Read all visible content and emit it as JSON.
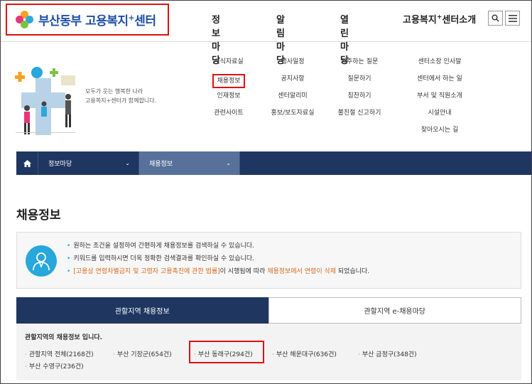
{
  "header": {
    "logo_text": "부산동부 고용복지",
    "logo_sup": "+",
    "logo_suffix": "센터",
    "nav": [
      "정보마당",
      "알림마당",
      "열린마당"
    ],
    "nav_last_prefix": "고용복지",
    "nav_last_sup": "+",
    "nav_last_suffix": "센터소개"
  },
  "mega": {
    "slogan_line1": "모두가 웃는 행복한 나라",
    "slogan_line2": "고용복지+센터가 함께합니다.",
    "col1": [
      "서식자료실",
      "채용정보",
      "인재정보",
      "관련사이트"
    ],
    "col2": [
      "행사일정",
      "공지사항",
      "센터알리미",
      "홍보/보도자료실"
    ],
    "col3": [
      "자주하는 질문",
      "질문하기",
      "칭찬하기",
      "불친절 신고하기"
    ],
    "col4": [
      "센터소장 인사말",
      "센터에서 하는 일",
      "부서 및 직원소개",
      "시설안내",
      "찾아오시는 길"
    ]
  },
  "locbar": {
    "item1": "정보마당",
    "item2": "채용정보"
  },
  "page_title": "채용정보",
  "info": {
    "line1": "원하는 조건을 설정하여 간편하게 채용정보를 검색하실 수 있습니다.",
    "line2": "키워드를 입력하시면 더욱 정확한 검색결과를 확인하실 수 있습니다.",
    "line3_law": "[고용상 연령차별금지 및 고령자 고용촉진에 관한 법률]",
    "line3_mid": "이 시행됨에 따라 ",
    "line3_orange": "채용정보에서 연령이 삭제",
    "line3_end": " 되었습니다."
  },
  "tabs": [
    "관할지역 채용정보",
    "관할지역 e-채용마당"
  ],
  "region": {
    "title": "관할지역의 채용정보 입니다.",
    "items": [
      "관할지역 전체(2168건)",
      "부산 기장군(654건)",
      "부산 동래구(294건)",
      "부산 해운대구(636건)",
      "부산 금정구(348건)",
      "부산 수영구(236건)"
    ]
  }
}
